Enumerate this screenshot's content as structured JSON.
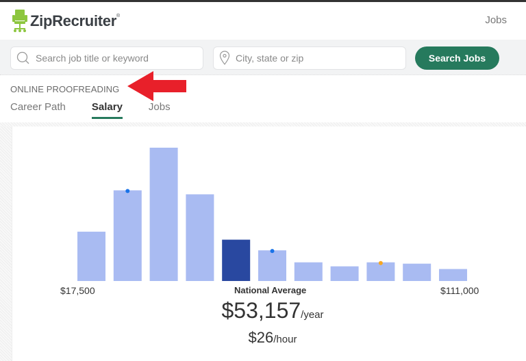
{
  "header": {
    "brand": "ZipRecruiter",
    "brand_mark": "®",
    "nav_jobs": "Jobs"
  },
  "search": {
    "keyword_placeholder": "Search job title or keyword",
    "location_placeholder": "City, state or zip",
    "button_label": "Search Jobs"
  },
  "page": {
    "category": "ONLINE PROOFREADING",
    "tabs": [
      {
        "label": "Career Path",
        "active": false
      },
      {
        "label": "Salary",
        "active": true
      },
      {
        "label": "Jobs",
        "active": false
      }
    ]
  },
  "colors": {
    "brand_green": "#267a5d",
    "bar_light": "#a9bbf2",
    "bar_highlight": "#2948a0",
    "marker_blue": "#1a73e8",
    "marker_orange": "#f5a623",
    "annotation_arrow": "#e8202a"
  },
  "chart_data": {
    "type": "bar",
    "title": "",
    "min_label": "$17,500",
    "max_label": "$111,000",
    "center_label": "National Average",
    "relative_values": [
      37,
      68,
      100,
      65,
      31,
      23,
      14,
      11,
      14,
      13,
      9
    ],
    "highlight_index": 4,
    "markers": [
      {
        "bar_index": 1,
        "color": "blue"
      },
      {
        "bar_index": 5,
        "color": "blue"
      },
      {
        "bar_index": 8,
        "color": "orange"
      }
    ],
    "grid": false
  },
  "salary": {
    "annual": "$53,157",
    "annual_unit": "/year",
    "hourly": "$26",
    "hourly_unit": "/hour"
  }
}
